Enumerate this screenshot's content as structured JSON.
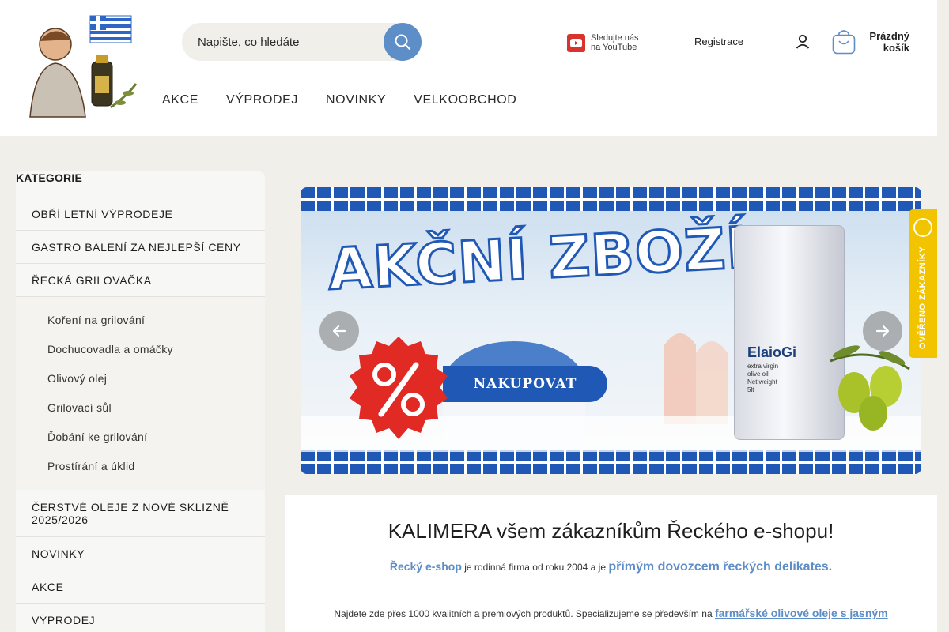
{
  "header": {
    "search_placeholder": "Napište, co hledáte",
    "youtube_line1": "Sledujte nás",
    "youtube_line2": "na YouTube",
    "registration": "Registrace",
    "cart_line1": "Prázdný",
    "cart_line2": "košík"
  },
  "nav": [
    {
      "label": "AKCE"
    },
    {
      "label": "VÝPRODEJ"
    },
    {
      "label": "NOVINKY"
    },
    {
      "label": "VELKOOBCHOD"
    }
  ],
  "sidebar": {
    "title": "KATEGORIE",
    "items_top": [
      {
        "label": "OBŘÍ LETNÍ VÝPRODEJE"
      },
      {
        "label": "GASTRO BALENÍ ZA NEJLEPŠÍ CENY"
      },
      {
        "label": "ŘECKÁ GRILOVAČKA"
      }
    ],
    "subitems": [
      {
        "label": "Koření na grilování"
      },
      {
        "label": "Dochucovadla a omáčky"
      },
      {
        "label": "Olivový olej"
      },
      {
        "label": "Grilovací sůl"
      },
      {
        "label": "Ďobání ke grilování"
      },
      {
        "label": "Prostírání a úklid"
      }
    ],
    "items_bottom": [
      {
        "label": "ČERSTVÉ OLEJE Z NOVÉ SKLIZNĚ 2025/2026"
      },
      {
        "label": "NOVINKY"
      },
      {
        "label": "AKCE"
      },
      {
        "label": "VÝPRODEJ"
      }
    ]
  },
  "banner": {
    "headline": "AKČNÍ ZBOŽÍ",
    "button": "NAKUPOVAT",
    "can_brand": "ElaioGi",
    "can_sub1": "extra virgin",
    "can_sub2": "olive oil",
    "can_sub3": "Net weight",
    "can_sub4": "5lt"
  },
  "verified_badge": "OVĚŘENO ZÁKAZNÍKY",
  "welcome": {
    "title": "KALIMERA všem zákazníkům Řeckého e-shopu!",
    "shop_name": "Řecký e-shop",
    "mid_text": " je rodinná firma  od roku 2004 a je ",
    "highlight": "přímým dovozcem řeckých delikates.",
    "line3_text": "Najdete zde přes 1000 kvalitních a premiových produktů. Specializujeme se především na ",
    "line3_link": "farmářské olivové oleje s jasným"
  },
  "colors": {
    "accent": "#5d8ec7",
    "banner_blue": "#1f58b5",
    "badge_yellow": "#f2c400",
    "page_bg": "#f0efea"
  }
}
